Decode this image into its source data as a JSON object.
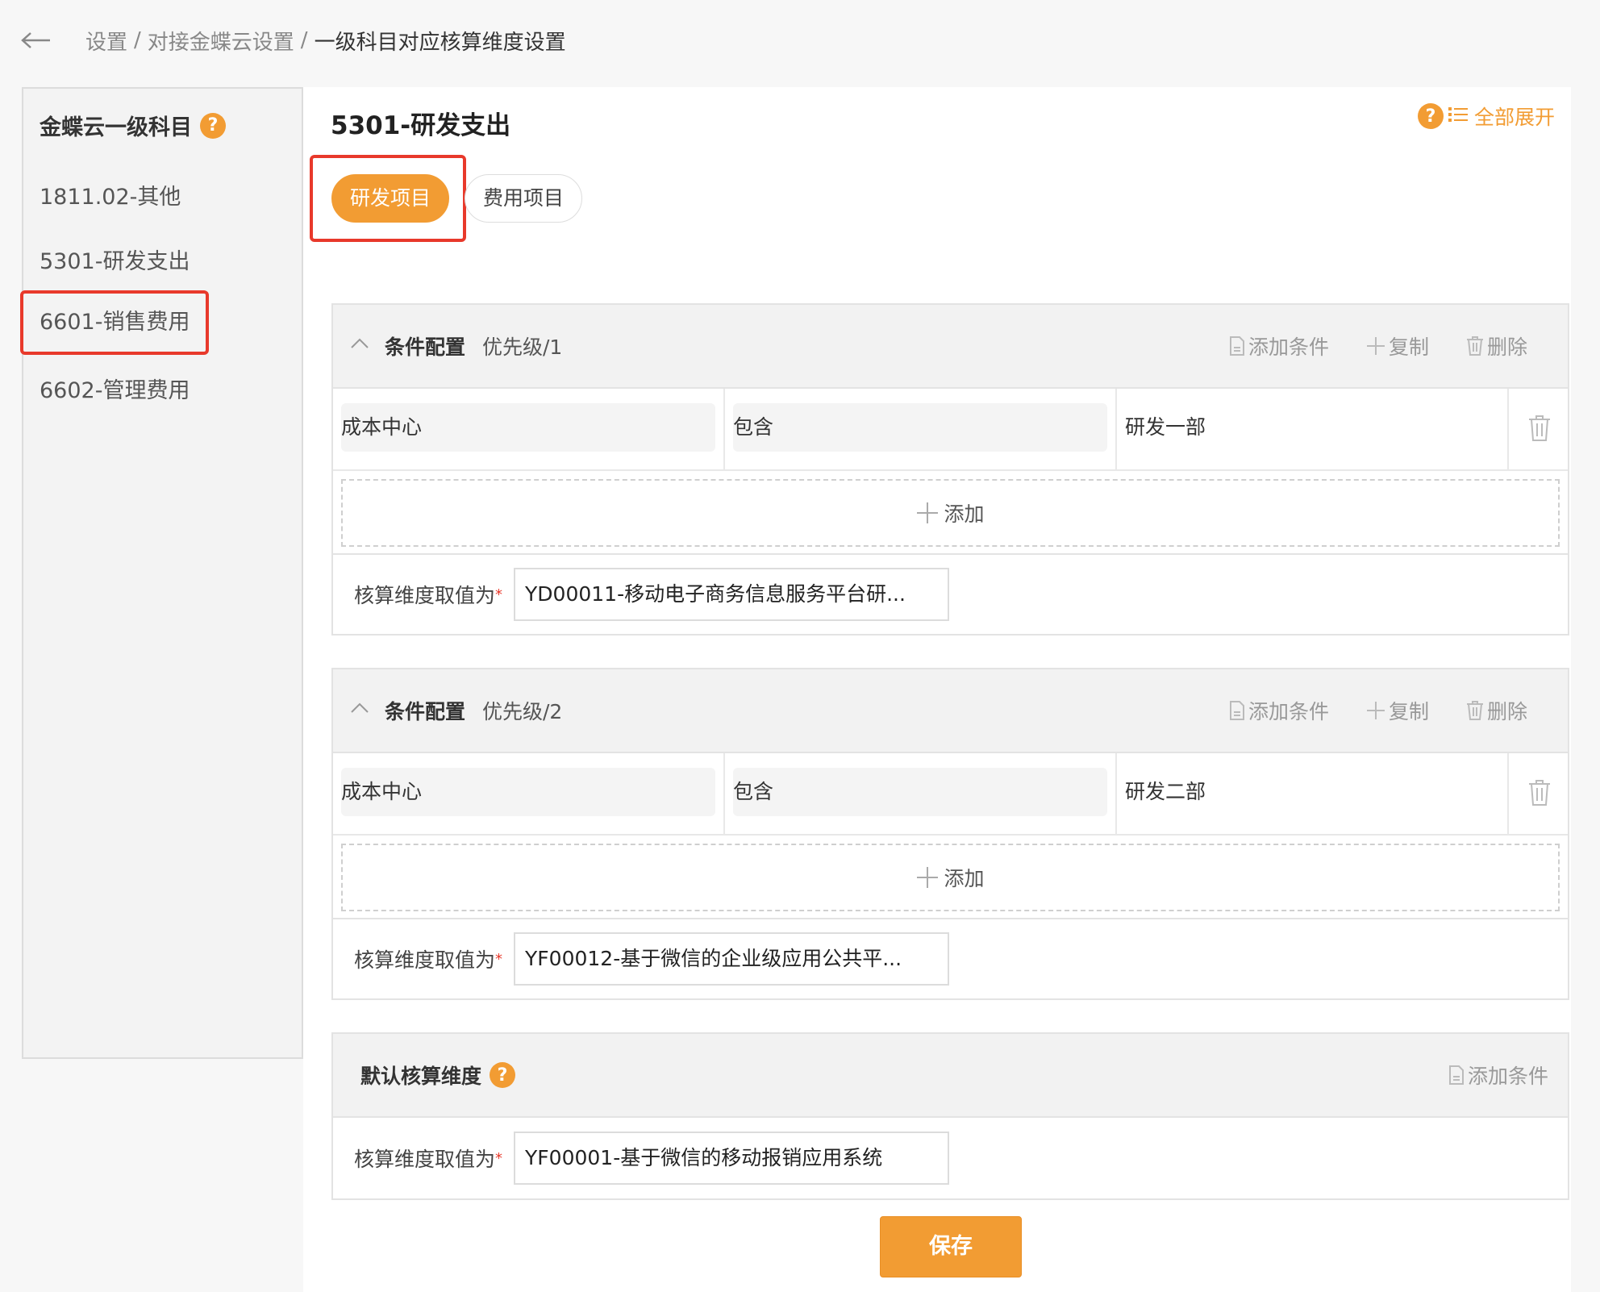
{
  "breadcrumb": {
    "items": [
      "设置",
      "对接金蝶云设置"
    ],
    "separator": "/",
    "current": "一级科目对应核算维度设置"
  },
  "sidebar": {
    "title": "金蝶云一级科目",
    "help": "?",
    "items": [
      {
        "label": "1811.02-其他"
      },
      {
        "label": "5301-研发支出"
      },
      {
        "label": "6601-销售费用",
        "highlighted": true
      },
      {
        "label": "6602-管理费用"
      }
    ]
  },
  "main": {
    "title": "5301-研发支出",
    "expand_all": "全部展开",
    "help": "?",
    "tabs": [
      {
        "label": "研发项目",
        "active": true
      },
      {
        "label": "费用项目",
        "active": false
      }
    ],
    "conditions": [
      {
        "title": "条件配置",
        "priority": "优先级/1",
        "actions": {
          "add": "添加条件",
          "copy": "复制",
          "delete": "删除"
        },
        "row": {
          "field": "成本中心",
          "operator": "包含",
          "value": "研发一部"
        },
        "add_label": "添加",
        "value_label": "核算维度取值为",
        "required_mark": "*",
        "value": "YD00011-移动电子商务信息服务平台研..."
      },
      {
        "title": "条件配置",
        "priority": "优先级/2",
        "actions": {
          "add": "添加条件",
          "copy": "复制",
          "delete": "删除"
        },
        "row": {
          "field": "成本中心",
          "operator": "包含",
          "value": "研发二部"
        },
        "add_label": "添加",
        "value_label": "核算维度取值为",
        "required_mark": "*",
        "value": "YF00012-基于微信的企业级应用公共平..."
      }
    ],
    "default": {
      "title": "默认核算维度",
      "help": "?",
      "add_label": "添加条件",
      "value_label": "核算维度取值为",
      "required_mark": "*",
      "value": "YF00001-基于微信的移动报销应用系统"
    },
    "save_label": "保存"
  },
  "colors": {
    "accent": "#f29c33",
    "highlight": "#e8392b"
  }
}
